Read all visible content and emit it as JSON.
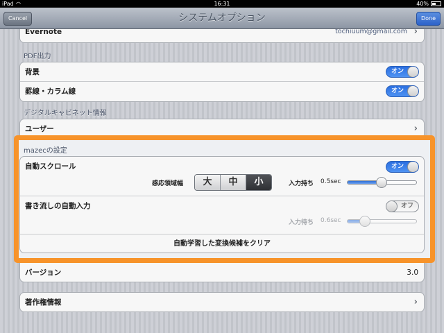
{
  "status_bar": {
    "carrier": "iPad",
    "time": "16:31",
    "battery": "40%"
  },
  "nav": {
    "title": "システムオプション",
    "cancel_label": "Cancel",
    "done_label": "Done"
  },
  "evernote_row": {
    "label": "Evernote",
    "value": "tochiuum@gmail.com"
  },
  "pdf_section": {
    "header": "PDF出力",
    "rows": [
      {
        "label": "背景",
        "toggle": "オン"
      },
      {
        "label": "罫線・カラム線",
        "toggle": "オン"
      }
    ]
  },
  "cabinet_section": {
    "header": "デジタルキャビネット情報",
    "user_label": "ユーザー"
  },
  "mazec_section": {
    "header": "mazecの設定",
    "auto_scroll": {
      "label": "自動スクロール",
      "toggle": "オン",
      "sensitivity_label": "感応領域幅",
      "segments": [
        "大",
        "中",
        "小"
      ],
      "selected_segment": "小",
      "wait_label": "入力持ち",
      "wait_value": "0.5sec",
      "slider_level": 0.49
    },
    "auto_input": {
      "label": "書き流しの自動入力",
      "toggle": "オフ",
      "wait_label": "入力待ち",
      "wait_value": "0.6sec",
      "slider_level": 0.25
    },
    "clear_label": "自動学習した変換候補をクリア"
  },
  "version_row": {
    "label": "バージョン",
    "value": "3.0"
  },
  "copyright_row": {
    "label": "著作権情報"
  },
  "colors": {
    "highlight": "#f7932a",
    "toggle_on": "#2b6fe0",
    "done_button": "#2c62c9"
  }
}
